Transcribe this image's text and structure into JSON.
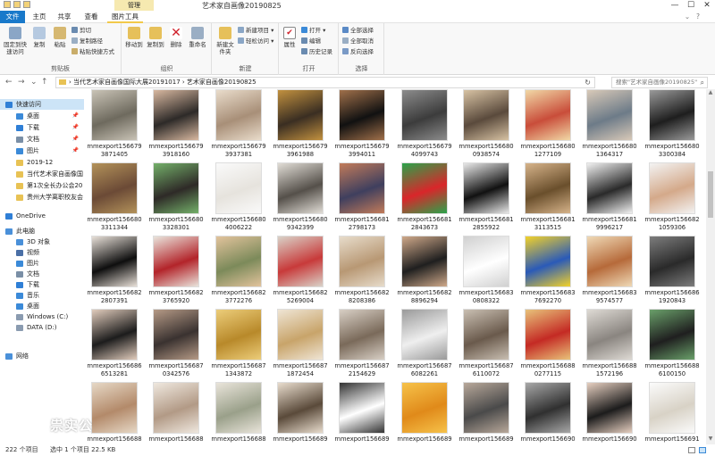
{
  "window": {
    "title": "艺术家自画像20190825",
    "manage_tab": "管理",
    "minimize": "—",
    "maximize": "☐",
    "close": "✕"
  },
  "tabs": [
    "文件",
    "主页",
    "共享",
    "查看",
    "图片工具"
  ],
  "ribbon": {
    "groups": [
      {
        "label": "剪贴板",
        "buttons": [
          "固定到快速访问",
          "复制",
          "粘贴"
        ],
        "small": [
          "剪切",
          "复制路径",
          "粘贴快捷方式"
        ]
      },
      {
        "label": "组织",
        "buttons": [
          "移动到",
          "复制到",
          "删除",
          "重命名"
        ]
      },
      {
        "label": "新建",
        "buttons": [
          "新建文件夹"
        ],
        "small": [
          "新建项目 ▾",
          "轻松访问 ▾"
        ]
      },
      {
        "label": "打开",
        "buttons": [
          "属性"
        ],
        "small": [
          "打开 ▾",
          "编辑",
          "历史记录"
        ]
      },
      {
        "label": "选择",
        "small": [
          "全部选择",
          "全部取消",
          "反向选择"
        ]
      }
    ]
  },
  "address": {
    "back": "←",
    "forward": "→",
    "up_list": "⌄",
    "up": "↑",
    "path": "› 当代艺术家自画像国际大展20191017 › 艺术家自画像20190825",
    "refresh": "↻",
    "search_placeholder": "搜索\"艺术家自画像20190825\"",
    "search_icon": "⌕"
  },
  "nav": [
    {
      "label": "快速访问",
      "icon": "star-icon",
      "color": "#2f7fd6",
      "indent": 6,
      "selected": true
    },
    {
      "label": "桌面",
      "icon": "desktop-icon",
      "color": "#3b8ad8",
      "indent": 18,
      "pin": "📌"
    },
    {
      "label": "下载",
      "icon": "download-icon",
      "color": "#2f7fd6",
      "indent": 18,
      "pin": "📌"
    },
    {
      "label": "文档",
      "icon": "documents-icon",
      "color": "#7a8fa6",
      "indent": 18,
      "pin": "📌"
    },
    {
      "label": "图片",
      "icon": "pictures-icon",
      "color": "#3b8ad8",
      "indent": 18,
      "pin": "📌"
    },
    {
      "label": "2019-12",
      "icon": "folder-icon",
      "color": "#e8c254",
      "indent": 18
    },
    {
      "label": "当代艺术家自画像国",
      "icon": "folder-icon",
      "color": "#e8c254",
      "indent": 18
    },
    {
      "label": "第1次全长办公会20",
      "icon": "folder-icon",
      "color": "#e8c254",
      "indent": 18
    },
    {
      "label": "贵州大学离职校友会",
      "icon": "folder-icon",
      "color": "#e8c254",
      "indent": 18
    },
    {
      "label": "OneDrive",
      "icon": "cloud-icon",
      "color": "#2f7fd6",
      "indent": 6
    },
    {
      "label": "此电脑",
      "icon": "computer-icon",
      "color": "#4a90d9",
      "indent": 6
    },
    {
      "label": "3D 对象",
      "icon": "cube-icon",
      "color": "#4a90d9",
      "indent": 18
    },
    {
      "label": "视频",
      "icon": "video-icon",
      "color": "#4a6fa6",
      "indent": 18
    },
    {
      "label": "图片",
      "icon": "pictures-icon",
      "color": "#3b8ad8",
      "indent": 18
    },
    {
      "label": "文档",
      "icon": "documents-icon",
      "color": "#7a8fa6",
      "indent": 18
    },
    {
      "label": "下载",
      "icon": "download-icon",
      "color": "#2f7fd6",
      "indent": 18
    },
    {
      "label": "音乐",
      "icon": "music-icon",
      "color": "#3b8ad8",
      "indent": 18
    },
    {
      "label": "桌面",
      "icon": "desktop-icon",
      "color": "#3b8ad8",
      "indent": 18
    },
    {
      "label": "Windows (C:)",
      "icon": "drive-icon",
      "color": "#8a9bb0",
      "indent": 18
    },
    {
      "label": "DATA (D:)",
      "icon": "drive-icon",
      "color": "#8a9bb0",
      "indent": 18
    },
    {
      "label": "网络",
      "icon": "network-icon",
      "color": "#4a90d9",
      "indent": 6
    }
  ],
  "files": [
    {
      "l1": "mmexport156679",
      "l2": "3871405",
      "c": "#6e6a5e",
      "c2": "#c9c3b6"
    },
    {
      "l1": "mmexport156679",
      "l2": "3918160",
      "c": "#2d2a28",
      "c2": "#d8b8a0"
    },
    {
      "l1": "mmexport156679",
      "l2": "3937381",
      "c": "#a88f78",
      "c2": "#e9dccb"
    },
    {
      "l1": "mmexport156679",
      "l2": "3961988",
      "c": "#3a2e22",
      "c2": "#c2913f"
    },
    {
      "l1": "mmexport156679",
      "l2": "3994011",
      "c": "#111111",
      "c2": "#a0704a"
    },
    {
      "l1": "mmexport156679",
      "l2": "4099743",
      "c": "#3c3c3c",
      "c2": "#8c8c8c"
    },
    {
      "l1": "mmexport156680",
      "l2": "0938574",
      "c": "#5a4a3c",
      "c2": "#d7c2a3"
    },
    {
      "l1": "mmexport156680",
      "l2": "1277109",
      "c": "#c94d3a",
      "c2": "#f1d8a6"
    },
    {
      "l1": "mmexport156680",
      "l2": "1364317",
      "c": "#6d7b88",
      "c2": "#d8c9b8"
    },
    {
      "l1": "mmexport156680",
      "l2": "3300384",
      "c": "#1e1e1e",
      "c2": "#9a9a9a"
    },
    {
      "l1": "mmexport156680",
      "l2": "3311344",
      "c": "#6b4a36",
      "c2": "#b3925a"
    },
    {
      "l1": "mmexport156680",
      "l2": "3328301",
      "c": "#2e2a27",
      "c2": "#74b06a"
    },
    {
      "l1": "mmexport156680",
      "l2": "4006222",
      "c": "#e6e3dd",
      "c2": "#fafafa"
    },
    {
      "l1": "mmexport156680",
      "l2": "9342399",
      "c": "#55504a",
      "c2": "#e1ddd6"
    },
    {
      "l1": "mmexport156681",
      "l2": "2798173",
      "c": "#3f3f5e",
      "c2": "#c27b5a"
    },
    {
      "l1": "mmexport156681",
      "l2": "2843673",
      "c": "#d9262a",
      "c2": "#2aa34a"
    },
    {
      "l1": "mmexport156681",
      "l2": "2855922",
      "c": "#111111",
      "c2": "#e8e8e8"
    },
    {
      "l1": "mmexport156681",
      "l2": "3113515",
      "c": "#6a4f2c",
      "c2": "#d6b38a"
    },
    {
      "l1": "mmexport156681",
      "l2": "9996217",
      "c": "#2a2a2a",
      "c2": "#f0f0f0"
    },
    {
      "l1": "mmexport156682",
      "l2": "1059306",
      "c": "#d4a98a",
      "c2": "#f3f3f3"
    },
    {
      "l1": "mmexport156682",
      "l2": "2807391",
      "c": "#0e0e0e",
      "c2": "#e8e0d8"
    },
    {
      "l1": "mmexport156682",
      "l2": "3765920",
      "c": "#b3242a",
      "c2": "#e9e4dc"
    },
    {
      "l1": "mmexport156682",
      "l2": "3772276",
      "c": "#7c8a5a",
      "c2": "#e2c39c"
    },
    {
      "l1": "mmexport156682",
      "l2": "5269004",
      "c": "#c83a3a",
      "c2": "#d9d2c8"
    },
    {
      "l1": "mmexport156682",
      "l2": "8208386",
      "c": "#b89874",
      "c2": "#e7dccb"
    },
    {
      "l1": "mmexport156682",
      "l2": "8896294",
      "c": "#1f1f1f",
      "c2": "#cfa98a"
    },
    {
      "l1": "mmexport156683",
      "l2": "0808322",
      "c": "#ffffff",
      "c2": "#d0d0d0"
    },
    {
      "l1": "mmexport156683",
      "l2": "7692270",
      "c": "#2a5ab8",
      "c2": "#f2d22a"
    },
    {
      "l1": "mmexport156683",
      "l2": "9574577",
      "c": "#b66a3a",
      "c2": "#efd9b6"
    },
    {
      "l1": "mmexport156686",
      "l2": "1920843",
      "c": "#2a2a2a",
      "c2": "#7d7d7d"
    },
    {
      "l1": "mmexport156686",
      "l2": "6513281",
      "c": "#1c1c1c",
      "c2": "#e1ccbc"
    },
    {
      "l1": "mmexport156687",
      "l2": "0342576",
      "c": "#3a3230",
      "c2": "#b59a86"
    },
    {
      "l1": "mmexport156687",
      "l2": "1343872",
      "c": "#b8892a",
      "c2": "#eccd7a"
    },
    {
      "l1": "mmexport156687",
      "l2": "1872454",
      "c": "#c8a46a",
      "c2": "#efe5d5"
    },
    {
      "l1": "mmexport156687",
      "l2": "2154629",
      "c": "#7a6a5a",
      "c2": "#d8cfc5"
    },
    {
      "l1": "mmexport156687",
      "l2": "6082261",
      "c": "#efefef",
      "c2": "#9a9a9a"
    },
    {
      "l1": "mmexport156687",
      "l2": "6110072",
      "c": "#6a5a4c",
      "c2": "#c9bfb2"
    },
    {
      "l1": "mmexport156688",
      "l2": "0277115",
      "c": "#c42a24",
      "c2": "#e8c27a"
    },
    {
      "l1": "mmexport156688",
      "l2": "1572196",
      "c": "#8a8580",
      "c2": "#dedad4"
    },
    {
      "l1": "mmexport156688",
      "l2": "6100150",
      "c": "#1f1f1f",
      "c2": "#6aa06a"
    },
    {
      "l1": "mmexport156688",
      "l2": "",
      "c": "#b38a6a",
      "c2": "#e6d8c6"
    },
    {
      "l1": "mmexport156688",
      "l2": "",
      "c": "#b29a86",
      "c2": "#efe8df"
    },
    {
      "l1": "mmexport156688",
      "l2": "",
      "c": "#9aa08a",
      "c2": "#e9e4da"
    },
    {
      "l1": "mmexport156689",
      "l2": "",
      "c": "#5a4a3a",
      "c2": "#e8dccd"
    },
    {
      "l1": "mmexport156689",
      "l2": "",
      "c": "#ffffff",
      "c2": "#333333"
    },
    {
      "l1": "mmexport156689",
      "l2": "",
      "c": "#e08a1a",
      "c2": "#f6c24a"
    },
    {
      "l1": "mmexport156689",
      "l2": "",
      "c": "#4a4a4a",
      "c2": "#b8a89a"
    },
    {
      "l1": "mmexport156690",
      "l2": "",
      "c": "#303030",
      "c2": "#a8a8a8"
    },
    {
      "l1": "mmexport156690",
      "l2": "",
      "c": "#1c1c1c",
      "c2": "#e6cfc0"
    },
    {
      "l1": "mmexport156691",
      "l2": "",
      "c": "#d8d2c6",
      "c2": "#fbfbfb"
    }
  ],
  "status": {
    "count": "222 个项目",
    "selected": "选中 1 个项目  22.5 KB"
  },
  "watermark": {
    "text": "祟实公"
  }
}
